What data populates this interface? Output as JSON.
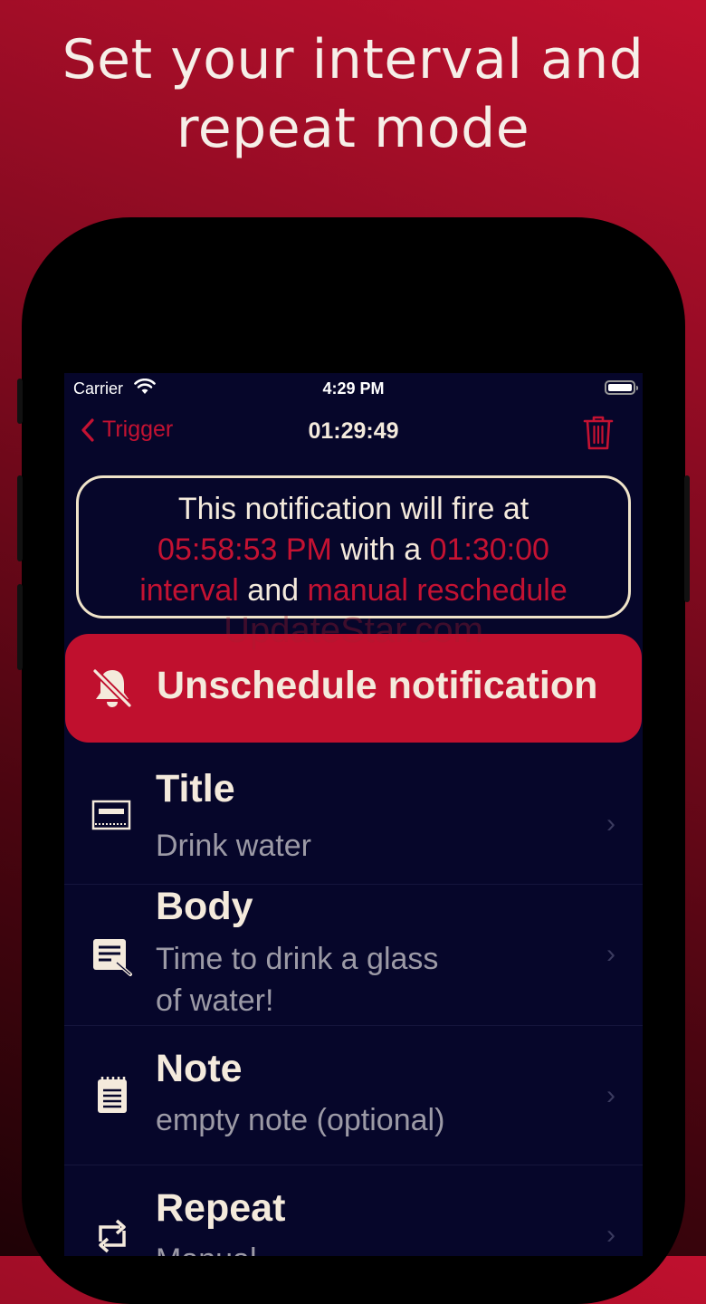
{
  "headline": {
    "line1": "Set your interval and",
    "line2": "repeat mode"
  },
  "status_bar": {
    "carrier": "Carrier",
    "time": "4:29 PM"
  },
  "nav": {
    "back_label": "Trigger",
    "title": "01:29:49"
  },
  "info": {
    "part1": "This notification will fire at",
    "fire_time": "05:58:53 PM",
    "part2": "with a",
    "interval": "01:30:00",
    "interval_word": "interval",
    "part3": "and",
    "mode": "manual reschedule"
  },
  "watermark": "UpdateStar.com",
  "unschedule_label": "Unschedule notification",
  "rows": [
    {
      "title": "Title",
      "value": "Drink water",
      "icon": "title-icon"
    },
    {
      "title": "Body",
      "value_line1": "Time to drink a glass",
      "value_line2": "of water!",
      "icon": "body-icon"
    },
    {
      "title": "Note",
      "value": "empty note (optional)",
      "icon": "note-icon"
    },
    {
      "title": "Repeat",
      "value": "Manual",
      "icon": "repeat-icon"
    }
  ],
  "colors": {
    "accent": "#c41232",
    "text": "#f4eadc",
    "background": "#06062a"
  }
}
